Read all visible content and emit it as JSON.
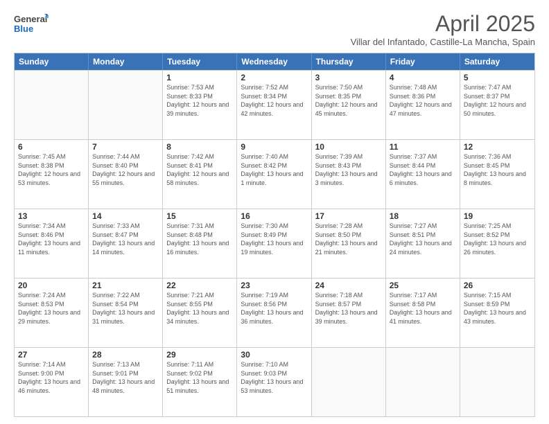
{
  "header": {
    "logo_general": "General",
    "logo_blue": "Blue",
    "title": "April 2025",
    "subtitle": "Villar del Infantado, Castille-La Mancha, Spain"
  },
  "days_of_week": [
    "Sunday",
    "Monday",
    "Tuesday",
    "Wednesday",
    "Thursday",
    "Friday",
    "Saturday"
  ],
  "weeks": [
    [
      {
        "day": "",
        "info": ""
      },
      {
        "day": "",
        "info": ""
      },
      {
        "day": "1",
        "info": "Sunrise: 7:53 AM\nSunset: 8:33 PM\nDaylight: 12 hours and 39 minutes."
      },
      {
        "day": "2",
        "info": "Sunrise: 7:52 AM\nSunset: 8:34 PM\nDaylight: 12 hours and 42 minutes."
      },
      {
        "day": "3",
        "info": "Sunrise: 7:50 AM\nSunset: 8:35 PM\nDaylight: 12 hours and 45 minutes."
      },
      {
        "day": "4",
        "info": "Sunrise: 7:48 AM\nSunset: 8:36 PM\nDaylight: 12 hours and 47 minutes."
      },
      {
        "day": "5",
        "info": "Sunrise: 7:47 AM\nSunset: 8:37 PM\nDaylight: 12 hours and 50 minutes."
      }
    ],
    [
      {
        "day": "6",
        "info": "Sunrise: 7:45 AM\nSunset: 8:38 PM\nDaylight: 12 hours and 53 minutes."
      },
      {
        "day": "7",
        "info": "Sunrise: 7:44 AM\nSunset: 8:40 PM\nDaylight: 12 hours and 55 minutes."
      },
      {
        "day": "8",
        "info": "Sunrise: 7:42 AM\nSunset: 8:41 PM\nDaylight: 12 hours and 58 minutes."
      },
      {
        "day": "9",
        "info": "Sunrise: 7:40 AM\nSunset: 8:42 PM\nDaylight: 13 hours and 1 minute."
      },
      {
        "day": "10",
        "info": "Sunrise: 7:39 AM\nSunset: 8:43 PM\nDaylight: 13 hours and 3 minutes."
      },
      {
        "day": "11",
        "info": "Sunrise: 7:37 AM\nSunset: 8:44 PM\nDaylight: 13 hours and 6 minutes."
      },
      {
        "day": "12",
        "info": "Sunrise: 7:36 AM\nSunset: 8:45 PM\nDaylight: 13 hours and 8 minutes."
      }
    ],
    [
      {
        "day": "13",
        "info": "Sunrise: 7:34 AM\nSunset: 8:46 PM\nDaylight: 13 hours and 11 minutes."
      },
      {
        "day": "14",
        "info": "Sunrise: 7:33 AM\nSunset: 8:47 PM\nDaylight: 13 hours and 14 minutes."
      },
      {
        "day": "15",
        "info": "Sunrise: 7:31 AM\nSunset: 8:48 PM\nDaylight: 13 hours and 16 minutes."
      },
      {
        "day": "16",
        "info": "Sunrise: 7:30 AM\nSunset: 8:49 PM\nDaylight: 13 hours and 19 minutes."
      },
      {
        "day": "17",
        "info": "Sunrise: 7:28 AM\nSunset: 8:50 PM\nDaylight: 13 hours and 21 minutes."
      },
      {
        "day": "18",
        "info": "Sunrise: 7:27 AM\nSunset: 8:51 PM\nDaylight: 13 hours and 24 minutes."
      },
      {
        "day": "19",
        "info": "Sunrise: 7:25 AM\nSunset: 8:52 PM\nDaylight: 13 hours and 26 minutes."
      }
    ],
    [
      {
        "day": "20",
        "info": "Sunrise: 7:24 AM\nSunset: 8:53 PM\nDaylight: 13 hours and 29 minutes."
      },
      {
        "day": "21",
        "info": "Sunrise: 7:22 AM\nSunset: 8:54 PM\nDaylight: 13 hours and 31 minutes."
      },
      {
        "day": "22",
        "info": "Sunrise: 7:21 AM\nSunset: 8:55 PM\nDaylight: 13 hours and 34 minutes."
      },
      {
        "day": "23",
        "info": "Sunrise: 7:19 AM\nSunset: 8:56 PM\nDaylight: 13 hours and 36 minutes."
      },
      {
        "day": "24",
        "info": "Sunrise: 7:18 AM\nSunset: 8:57 PM\nDaylight: 13 hours and 39 minutes."
      },
      {
        "day": "25",
        "info": "Sunrise: 7:17 AM\nSunset: 8:58 PM\nDaylight: 13 hours and 41 minutes."
      },
      {
        "day": "26",
        "info": "Sunrise: 7:15 AM\nSunset: 8:59 PM\nDaylight: 13 hours and 43 minutes."
      }
    ],
    [
      {
        "day": "27",
        "info": "Sunrise: 7:14 AM\nSunset: 9:00 PM\nDaylight: 13 hours and 46 minutes."
      },
      {
        "day": "28",
        "info": "Sunrise: 7:13 AM\nSunset: 9:01 PM\nDaylight: 13 hours and 48 minutes."
      },
      {
        "day": "29",
        "info": "Sunrise: 7:11 AM\nSunset: 9:02 PM\nDaylight: 13 hours and 51 minutes."
      },
      {
        "day": "30",
        "info": "Sunrise: 7:10 AM\nSunset: 9:03 PM\nDaylight: 13 hours and 53 minutes."
      },
      {
        "day": "",
        "info": ""
      },
      {
        "day": "",
        "info": ""
      },
      {
        "day": "",
        "info": ""
      }
    ]
  ]
}
